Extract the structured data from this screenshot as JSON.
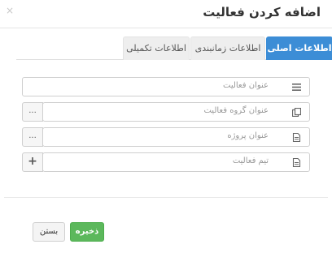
{
  "dialog": {
    "title": "اضافه کردن فعالیت",
    "close_glyph": "×"
  },
  "tabs": [
    {
      "label": "اطلاعات اصلی",
      "active": true
    },
    {
      "label": "اطلاعات زمانبندی",
      "active": false
    },
    {
      "label": "اطلاعات تکمیلی",
      "active": false
    }
  ],
  "fields": {
    "activity_title": {
      "placeholder": "عنوان فعالیت",
      "icon": "text-lines-icon"
    },
    "activity_group": {
      "placeholder": "عنوان گروه فعالیت",
      "icon": "copy-icon",
      "addon": "..."
    },
    "project_title": {
      "placeholder": "عنوان پروژه",
      "icon": "document-icon",
      "addon": "..."
    },
    "activity_team": {
      "placeholder": "تیم فعالیت",
      "icon": "document-icon",
      "addon": "+"
    }
  },
  "buttons": {
    "save": "ذخیره",
    "close": "بستن"
  },
  "colors": {
    "accent": "#3c8dd6",
    "save": "#5cb85c"
  }
}
